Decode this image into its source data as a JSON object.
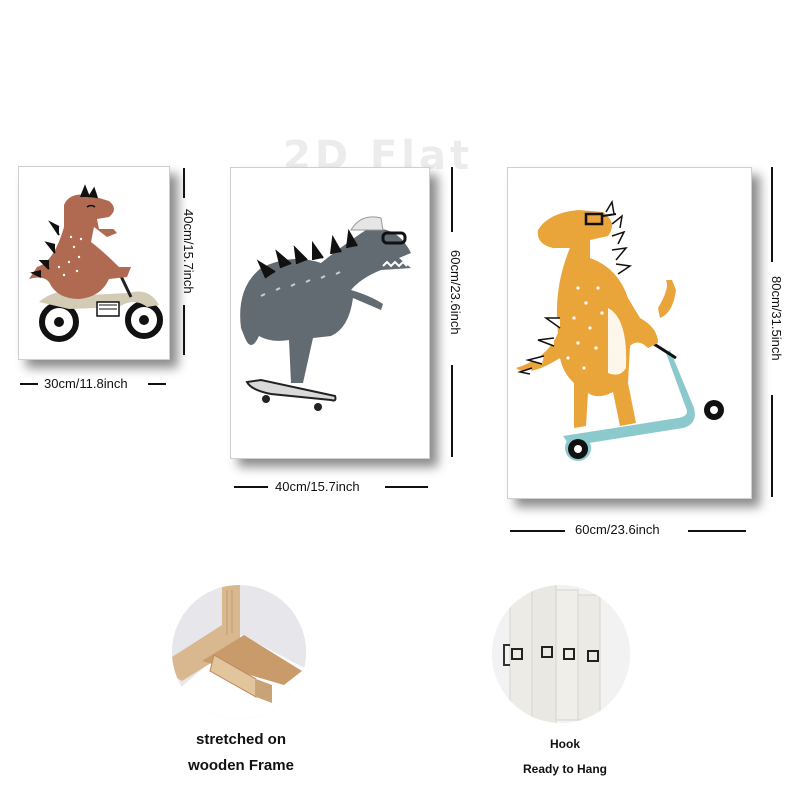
{
  "watermark": "2D Flat",
  "canvases": [
    {
      "width_label": "30cm/11.8inch",
      "height_label": "40cm/15.7inch",
      "subject": "dinosaur-on-motorcycle"
    },
    {
      "width_label": "40cm/15.7inch",
      "height_label": "60cm/23.6inch",
      "subject": "dinosaur-on-skateboard"
    },
    {
      "width_label": "60cm/23.6inch",
      "height_label": "80cm/31.5inch",
      "subject": "dinosaur-on-scooter"
    }
  ],
  "features": [
    {
      "caption_line1": "stretched on",
      "caption_line2": "wooden Frame"
    },
    {
      "caption_line1": "Hook",
      "caption_line2": "Ready to Hang"
    }
  ],
  "colors": {
    "brown_dino": "#b06a52",
    "gray_dino": "#626a72",
    "yellow_dino": "#e9a43a",
    "scooter": "#8cc9cc",
    "bike": "#d2cbb5"
  }
}
